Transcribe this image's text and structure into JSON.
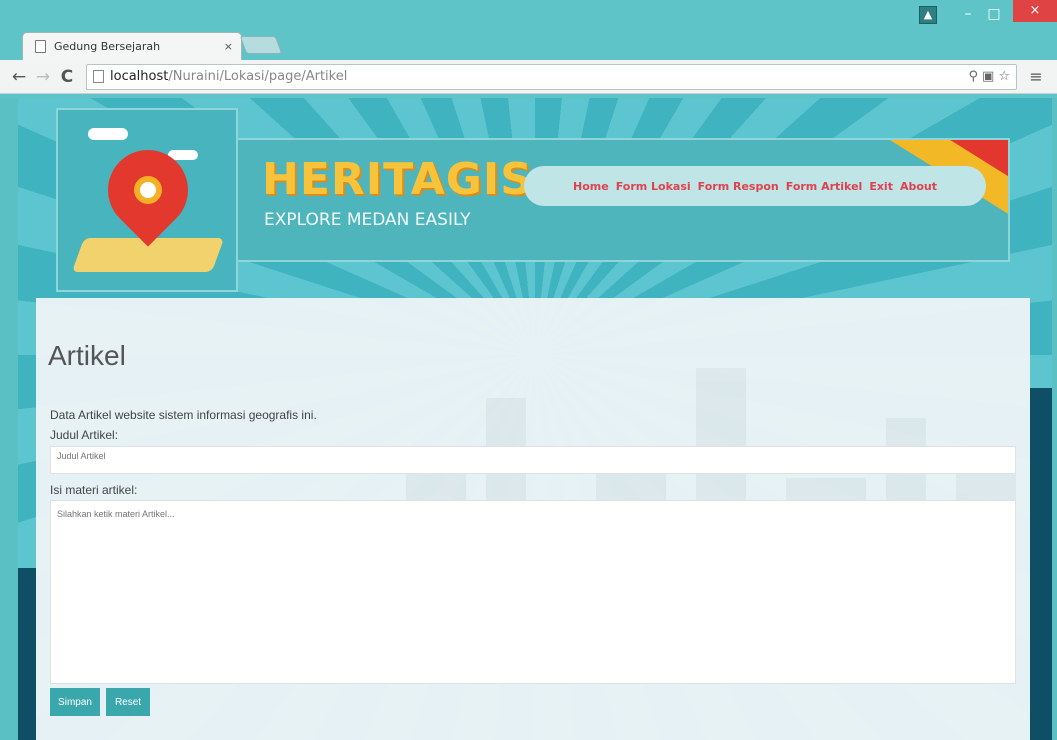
{
  "browser": {
    "tab_title": "Gedung Bersejarah",
    "tab_close": "×",
    "url_host": "localhost",
    "url_path": "/Nuraini/Lokasi/page/Artikel",
    "back": "←",
    "forward": "→",
    "reload": "C",
    "menu": "≡",
    "window_min": "–",
    "window_max": "□",
    "window_close": "×"
  },
  "header": {
    "brand": "HERITAGIS",
    "tagline": "EXPLORE MEDAN EASILY",
    "nav": [
      "Home",
      "Form Lokasi",
      "Form Respon",
      "Form Artikel",
      "Exit",
      "About"
    ]
  },
  "form": {
    "title": "Artikel",
    "description": "Data Artikel website sistem informasi geografis ini.",
    "judul_label": "Judul Artikel:",
    "judul_placeholder": "Judul Artikel",
    "isi_label": "Isi materi artikel:",
    "isi_placeholder": "Silahkan ketik materi Artikel...",
    "save_label": "Simpan",
    "reset_label": "Reset"
  },
  "colors": {
    "accent": "#3aa7ad",
    "nav_link": "#e0414f",
    "brand": "#f7c33a"
  }
}
